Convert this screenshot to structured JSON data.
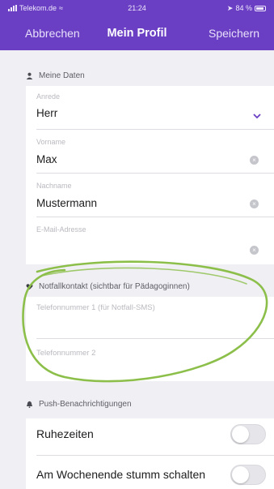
{
  "status_bar": {
    "carrier": "Telekom.de",
    "time": "21:24",
    "battery": "84 %"
  },
  "nav": {
    "cancel": "Abbrechen",
    "title": "Mein Profil",
    "save": "Speichern"
  },
  "meine_daten": {
    "header": "Meine Daten",
    "header_icon": "person-icon",
    "anrede": {
      "label": "Anrede",
      "value": "Herr"
    },
    "vorname": {
      "label": "Vorname",
      "value": "Max"
    },
    "nachname": {
      "label": "Nachname",
      "value": "Mustermann"
    },
    "email": {
      "label": "E-Mail-Adresse",
      "value": ""
    }
  },
  "notfall": {
    "header": "Notfallkontakt (sichtbar für Pädagoginnen)",
    "header_icon": "heart-icon",
    "tel1_placeholder": "Telefonnummer 1 (für Notfall-SMS)",
    "tel2_placeholder": "Telefonnummer 2"
  },
  "push": {
    "header": "Push-Benachrichtigungen",
    "header_icon": "bell-icon",
    "ruhezeiten": {
      "label": "Ruhezeiten",
      "on": false
    },
    "wochenende": {
      "label": "Am Wochenende stumm schalten",
      "on": false
    }
  },
  "colors": {
    "brand": "#6a3fc4",
    "annotation": "#8cbf4a"
  }
}
